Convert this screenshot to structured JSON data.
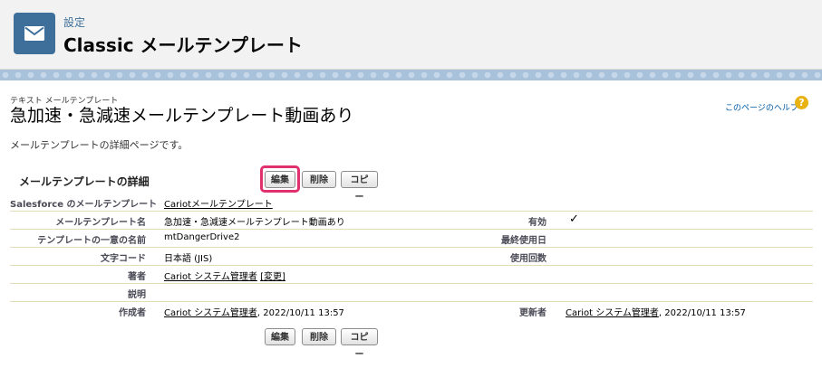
{
  "header": {
    "subtitle": "設定",
    "title": "Classic メールテンプレート",
    "icon": "email-icon"
  },
  "page": {
    "type_label": "テキスト メールテンプレート",
    "title": "急加速・急減速メールテンプレート動画あり",
    "help_link": "このページのヘルプ",
    "help_icon": "?",
    "description": "メールテンプレートの詳細ページです。"
  },
  "section": {
    "title": "メールテンプレートの詳細"
  },
  "buttons": {
    "edit": "編集",
    "delete": "削除",
    "copy": "コピー"
  },
  "detail": {
    "folder_label": "Salesforce のメールテンプレート",
    "folder_value": "Cariotメールテンプレート",
    "name_label": "メールテンプレート名",
    "name_value": "急加速・急減速メールテンプレート動画あり",
    "active_label": "有効",
    "active_value": "✓",
    "unique_name_label": "テンプレートの一意の名前",
    "unique_name_value": "mtDangerDrive2",
    "last_used_label": "最終使用日",
    "last_used_value": "",
    "encoding_label": "文字コード",
    "encoding_value": "日本語 (JIS)",
    "times_used_label": "使用回数",
    "times_used_value": "",
    "author_label": "著者",
    "author_value": "Cariot システム管理者",
    "author_change": "[変更]",
    "description_label": "説明",
    "description_value": "",
    "created_by_label": "作成者",
    "created_by_user": "Cariot システム管理者",
    "created_by_date": ", 2022/10/11 13:57",
    "modified_by_label": "更新者",
    "modified_by_user": "Cariot システム管理者",
    "modified_by_date": ", 2022/10/11 13:57"
  }
}
